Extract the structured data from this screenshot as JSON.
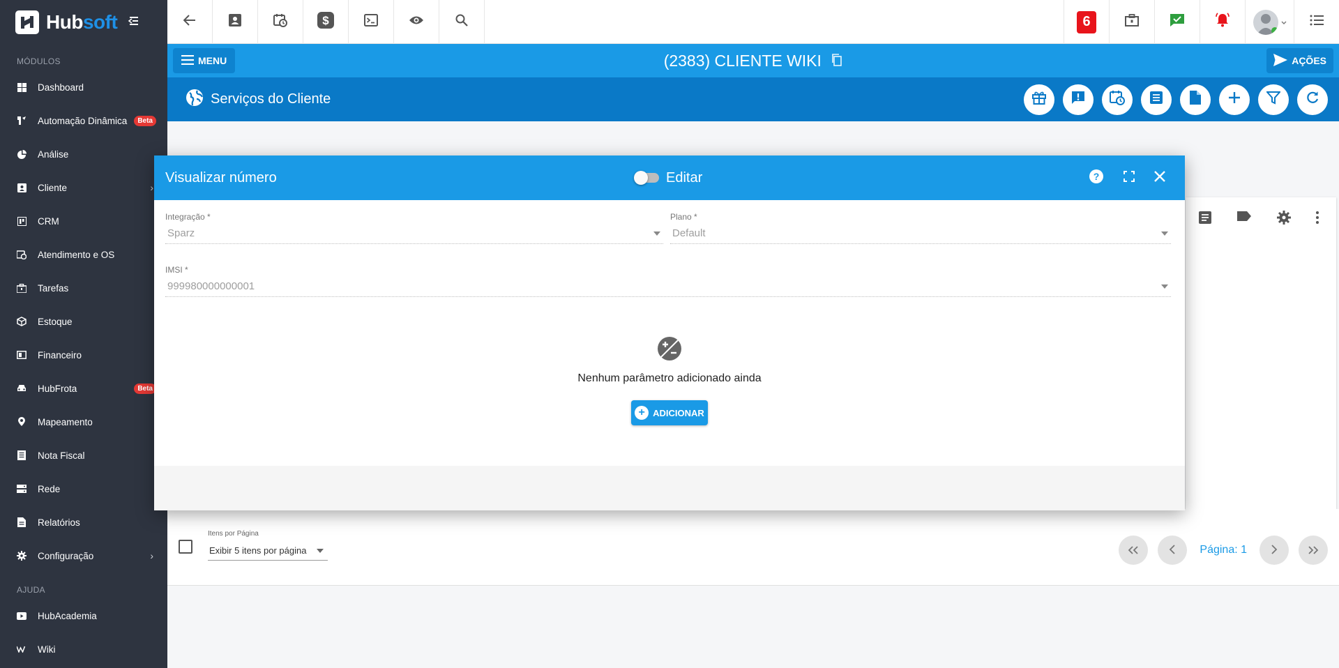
{
  "brand": {
    "name_part1": "Hub",
    "name_part2": "soft"
  },
  "sidebar": {
    "section_modules": "MÓDULOS",
    "section_help": "AJUDA",
    "badge_beta": "Beta",
    "items": [
      {
        "label": "Dashboard",
        "icon": "dashboard-icon"
      },
      {
        "label": "Automação Dinâmica",
        "icon": "automation-icon",
        "badge": "Beta"
      },
      {
        "label": "Análise",
        "icon": "pie-chart-icon"
      },
      {
        "label": "Cliente",
        "icon": "contact-card-icon"
      },
      {
        "label": "CRM",
        "icon": "board-icon"
      },
      {
        "label": "Atendimento e OS",
        "icon": "calendar-clock-icon"
      },
      {
        "label": "Tarefas",
        "icon": "briefcase-icon"
      },
      {
        "label": "Estoque",
        "icon": "box-icon"
      },
      {
        "label": "Financeiro",
        "icon": "money-icon"
      },
      {
        "label": "HubFrota",
        "icon": "car-icon",
        "badge": "Beta"
      },
      {
        "label": "Mapeamento",
        "icon": "map-pin-icon"
      },
      {
        "label": "Nota Fiscal",
        "icon": "receipt-icon"
      },
      {
        "label": "Rede",
        "icon": "server-icon"
      },
      {
        "label": "Relatórios",
        "icon": "report-icon"
      },
      {
        "label": "Configuração",
        "icon": "gear-icon"
      }
    ],
    "help_items": [
      {
        "label": "HubAcademia",
        "icon": "video-icon"
      },
      {
        "label": "Wiki",
        "icon": "wiki-icon"
      }
    ]
  },
  "topbar": {
    "notification_count": "6"
  },
  "client": {
    "menu_label": "MENU",
    "title": "(2383) CLIENTE WIKI",
    "actions_label": "AÇÕES"
  },
  "section": {
    "title": "Serviços do Cliente"
  },
  "footer": {
    "per_page_label": "Itens por Página",
    "per_page_value": "Exibir 5 itens por página",
    "page_label": "Página: 1"
  },
  "modal": {
    "title": "Visualizar número",
    "toggle_label": "Editar",
    "fields": {
      "integracao_label": "Integração *",
      "integracao_value": "Sparz",
      "plano_label": "Plano *",
      "plano_value": "Default",
      "imsi_label": "IMSI *",
      "imsi_value": "999980000000001"
    },
    "empty_text": "Nenhum parâmetro adicionado ainda",
    "add_label": "ADICIONAR"
  },
  "colors": {
    "sidebar_bg": "#2e3440",
    "primary": "#1a9ae6",
    "primary_dark": "#0a79c7",
    "badge_red": "#e53935"
  }
}
